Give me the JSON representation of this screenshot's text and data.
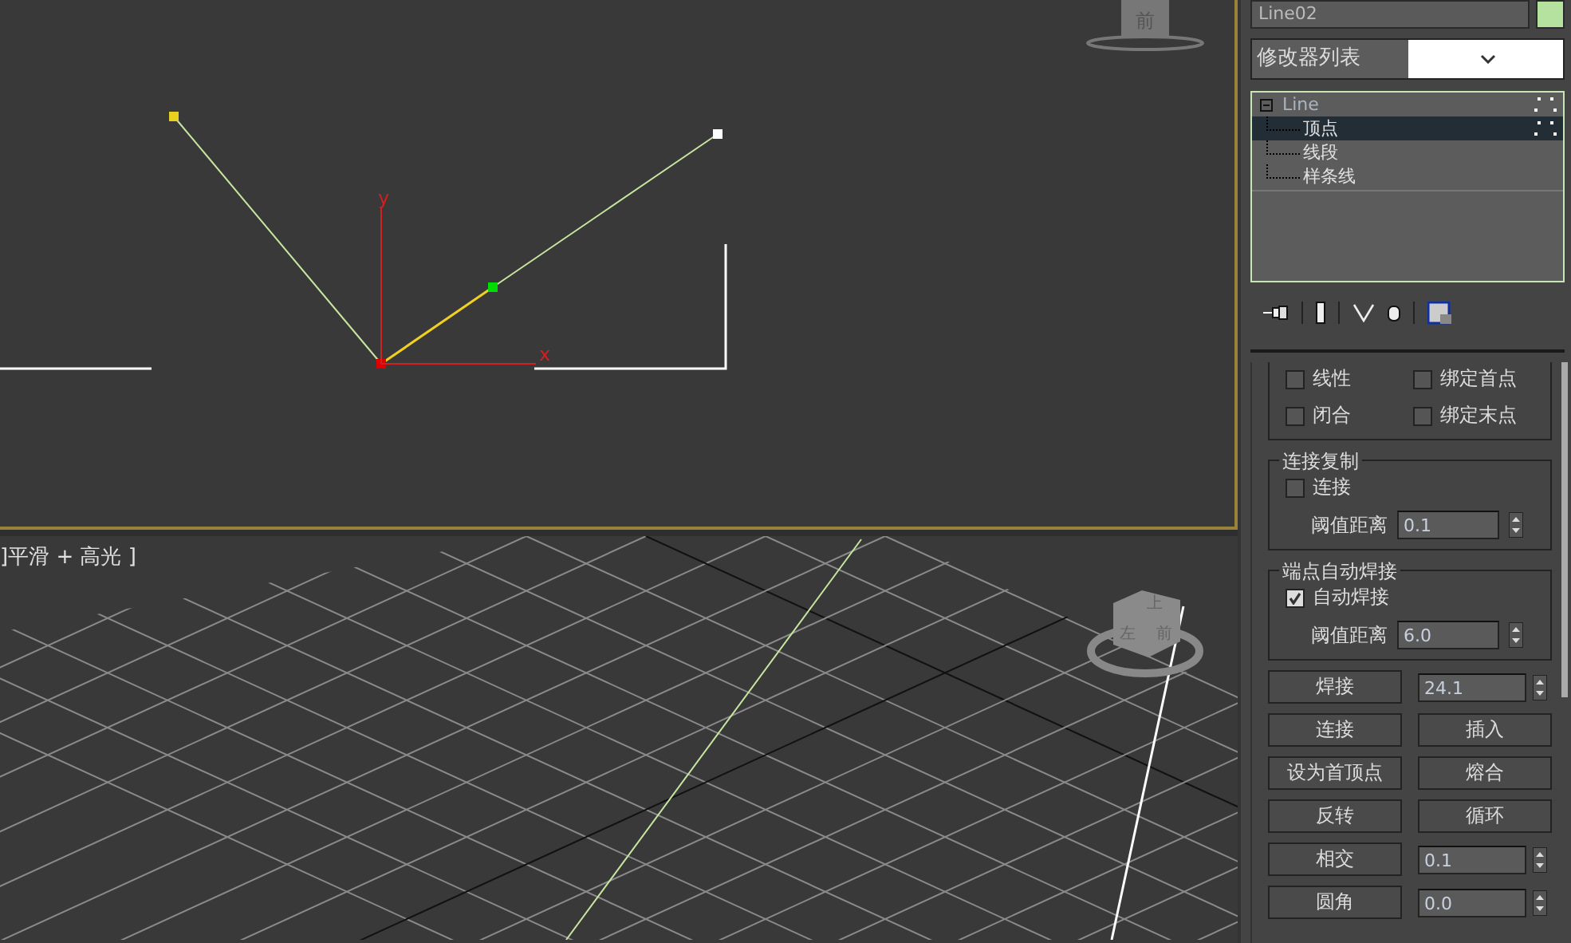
{
  "viewports": {
    "top": {
      "cube_label": "前",
      "axis_labels": [
        "y",
        "x"
      ]
    },
    "perspective": {
      "label": "]平滑 + 高光 ]",
      "cube_labels": [
        "上",
        "左",
        "前"
      ]
    }
  },
  "name_field": {
    "value": "Line02"
  },
  "modifier_list": {
    "value": "修改器列表"
  },
  "modifier_stack": [
    {
      "label": "Line",
      "selected": false,
      "expanded": true,
      "children": [
        {
          "label": "顶点",
          "selected": true
        },
        {
          "label": "线段",
          "selected": false
        },
        {
          "label": "样条线",
          "selected": false
        }
      ]
    }
  ],
  "rollout": {
    "options": [
      {
        "label": "线性",
        "checked": false
      },
      {
        "label": "绑定首点",
        "checked": false
      },
      {
        "label": "闭合",
        "checked": false
      },
      {
        "label": "绑定末点",
        "checked": false
      }
    ],
    "groups": [
      {
        "title": "连接复制",
        "checkbox": {
          "label": "连接",
          "checked": false
        },
        "threshold": {
          "label": "阈值距离",
          "value": "0.1"
        }
      },
      {
        "title": "端点自动焊接",
        "checkbox": {
          "label": "自动焊接",
          "checked": true
        },
        "threshold": {
          "label": "阈值距离",
          "value": "6.0"
        }
      }
    ],
    "actions": [
      {
        "kind": "button_spinner",
        "label": "焊接",
        "value": "24.1"
      },
      {
        "kind": "button_pair",
        "labels": [
          "连接",
          "插入"
        ]
      },
      {
        "kind": "button_pair",
        "labels": [
          "设为首顶点",
          "熔合"
        ]
      },
      {
        "kind": "button_pair",
        "labels": [
          "反转",
          "循环"
        ]
      },
      {
        "kind": "button_spinner",
        "label": "相交",
        "value": "0.1"
      },
      {
        "kind": "button_spinner",
        "label": "圆角",
        "value": "0.0"
      }
    ]
  }
}
